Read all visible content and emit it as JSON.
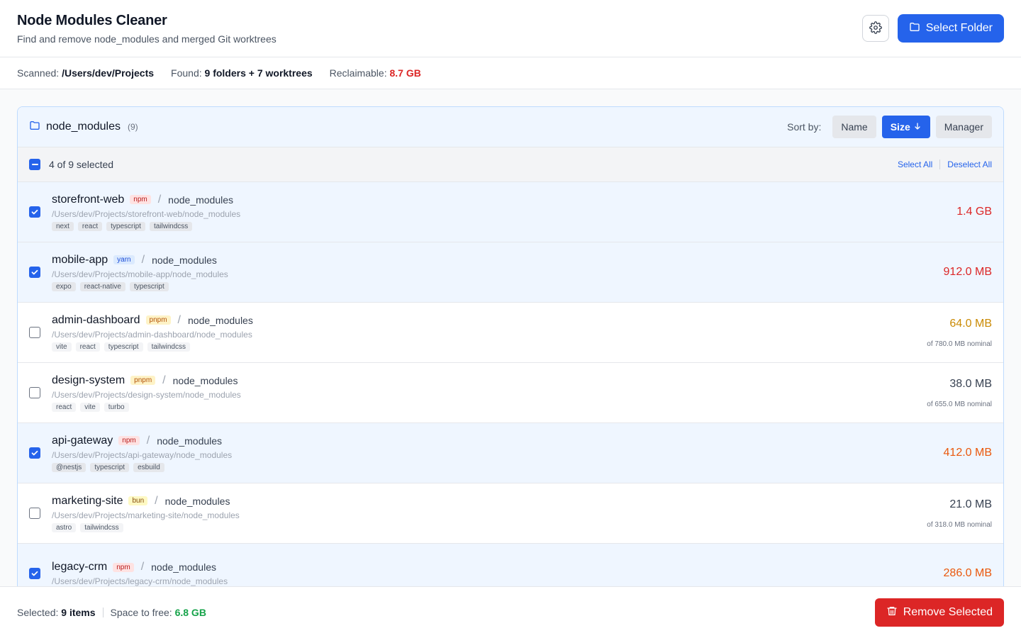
{
  "app": {
    "title": "Node Modules Cleaner",
    "subtitle": "Find and remove node_modules and merged Git worktrees",
    "select_folder_label": "Select Folder",
    "settings_icon": "gear-icon"
  },
  "stats": {
    "scanned_label": "Scanned:",
    "scanned_value": "/Users/dev/Projects",
    "found_label": "Found:",
    "found_value": "9 folders + 7 worktrees",
    "reclaimable_label": "Reclaimable:",
    "reclaimable_value": "8.7 GB"
  },
  "panel": {
    "title": "node_modules",
    "count": "(9)",
    "sort_label": "Sort by:",
    "sort_options": [
      "Name",
      "Size",
      "Manager"
    ],
    "sort_active": "Size",
    "sort_direction_icon": "arrow-down-icon",
    "selection_text": "4 of 9 selected",
    "select_all": "Select All",
    "deselect_all": "Deselect All"
  },
  "colors": {
    "accent": "#2563eb",
    "danger": "#dc2626",
    "success": "#16a34a",
    "warning": "#ca8a04",
    "orange": "#ea580c"
  },
  "items": [
    {
      "name": "storefront-web",
      "manager": "npm",
      "folder": "node_modules",
      "path": "/Users/dev/Projects/storefront-web/node_modules",
      "tags": [
        "next",
        "react",
        "typescript",
        "tailwindcss"
      ],
      "size": "1.4 GB",
      "size_color": "#dc2626",
      "nominal": "",
      "checked": true
    },
    {
      "name": "mobile-app",
      "manager": "yarn",
      "folder": "node_modules",
      "path": "/Users/dev/Projects/mobile-app/node_modules",
      "tags": [
        "expo",
        "react-native",
        "typescript"
      ],
      "size": "912.0 MB",
      "size_color": "#dc2626",
      "nominal": "",
      "checked": true
    },
    {
      "name": "admin-dashboard",
      "manager": "pnpm",
      "folder": "node_modules",
      "path": "/Users/dev/Projects/admin-dashboard/node_modules",
      "tags": [
        "vite",
        "react",
        "typescript",
        "tailwindcss"
      ],
      "size": "64.0 MB",
      "size_color": "#ca8a04",
      "nominal": "of 780.0 MB nominal",
      "checked": false
    },
    {
      "name": "design-system",
      "manager": "pnpm",
      "folder": "node_modules",
      "path": "/Users/dev/Projects/design-system/node_modules",
      "tags": [
        "react",
        "vite",
        "turbo"
      ],
      "size": "38.0 MB",
      "size_color": "#374151",
      "nominal": "of 655.0 MB nominal",
      "checked": false
    },
    {
      "name": "api-gateway",
      "manager": "npm",
      "folder": "node_modules",
      "path": "/Users/dev/Projects/api-gateway/node_modules",
      "tags": [
        "@nestjs",
        "typescript",
        "esbuild"
      ],
      "size": "412.0 MB",
      "size_color": "#ea580c",
      "nominal": "",
      "checked": true
    },
    {
      "name": "marketing-site",
      "manager": "bun",
      "folder": "node_modules",
      "path": "/Users/dev/Projects/marketing-site/node_modules",
      "tags": [
        "astro",
        "tailwindcss"
      ],
      "size": "21.0 MB",
      "size_color": "#374151",
      "nominal": "of 318.0 MB nominal",
      "checked": false
    },
    {
      "name": "legacy-crm",
      "manager": "npm",
      "folder": "node_modules",
      "path": "/Users/dev/Projects/legacy-crm/node_modules",
      "tags": [],
      "size": "286.0 MB",
      "size_color": "#ea580c",
      "nominal": "",
      "checked": true
    }
  ],
  "footer": {
    "selected_label": "Selected:",
    "selected_value": "9 items",
    "space_label": "Space to free:",
    "space_value": "6.8 GB",
    "remove_label": "Remove Selected",
    "remove_icon": "trash-icon"
  }
}
